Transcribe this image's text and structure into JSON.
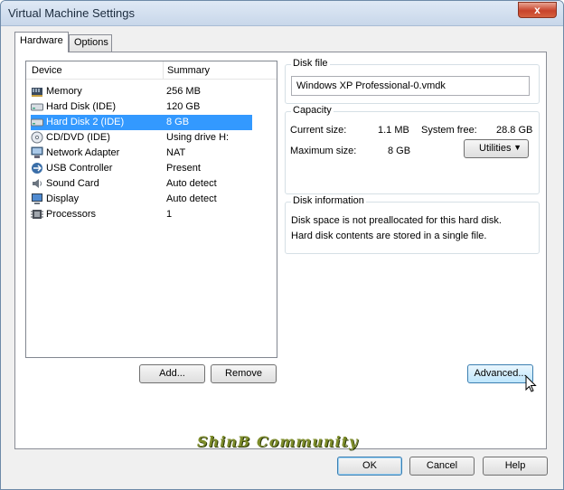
{
  "window": {
    "title": "Virtual Machine Settings",
    "close_label": "x"
  },
  "tabs": [
    {
      "label": "Hardware",
      "active": true
    },
    {
      "label": "Options",
      "active": false
    }
  ],
  "device_list": {
    "columns": {
      "device": "Device",
      "summary": "Summary"
    },
    "rows": [
      {
        "name": "Memory",
        "summary": "256 MB",
        "icon": "memory-icon"
      },
      {
        "name": "Hard Disk (IDE)",
        "summary": "120 GB",
        "icon": "hard-disk-icon"
      },
      {
        "name": "Hard Disk 2 (IDE)",
        "summary": "8 GB",
        "icon": "hard-disk-icon",
        "selected": true
      },
      {
        "name": "CD/DVD (IDE)",
        "summary": "Using drive H:",
        "icon": "cd-dvd-icon"
      },
      {
        "name": "Network Adapter",
        "summary": "NAT",
        "icon": "network-adapter-icon"
      },
      {
        "name": "USB Controller",
        "summary": "Present",
        "icon": "usb-icon"
      },
      {
        "name": "Sound Card",
        "summary": "Auto detect",
        "icon": "sound-card-icon"
      },
      {
        "name": "Display",
        "summary": "Auto detect",
        "icon": "display-icon"
      },
      {
        "name": "Processors",
        "summary": "1",
        "icon": "processor-icon"
      }
    ],
    "add_label": "Add...",
    "remove_label": "Remove"
  },
  "disk_file": {
    "legend": "Disk file",
    "value": "Windows XP Professional-0.vmdk"
  },
  "capacity": {
    "legend": "Capacity",
    "current_label": "Current size:",
    "current_value": "1.1 MB",
    "system_free_label": "System free:",
    "system_free_value": "28.8 GB",
    "max_label": "Maximum size:",
    "max_value": "8 GB",
    "utilities_label": "Utilities"
  },
  "disk_info": {
    "legend": "Disk information",
    "line1": "Disk space is not preallocated for this hard disk.",
    "line2": "Hard disk contents are stored in a single file."
  },
  "advanced_label": "Advanced...",
  "footer": {
    "ok_label": "OK",
    "cancel_label": "Cancel",
    "help_label": "Help",
    "watermark": "ShinB Community"
  }
}
